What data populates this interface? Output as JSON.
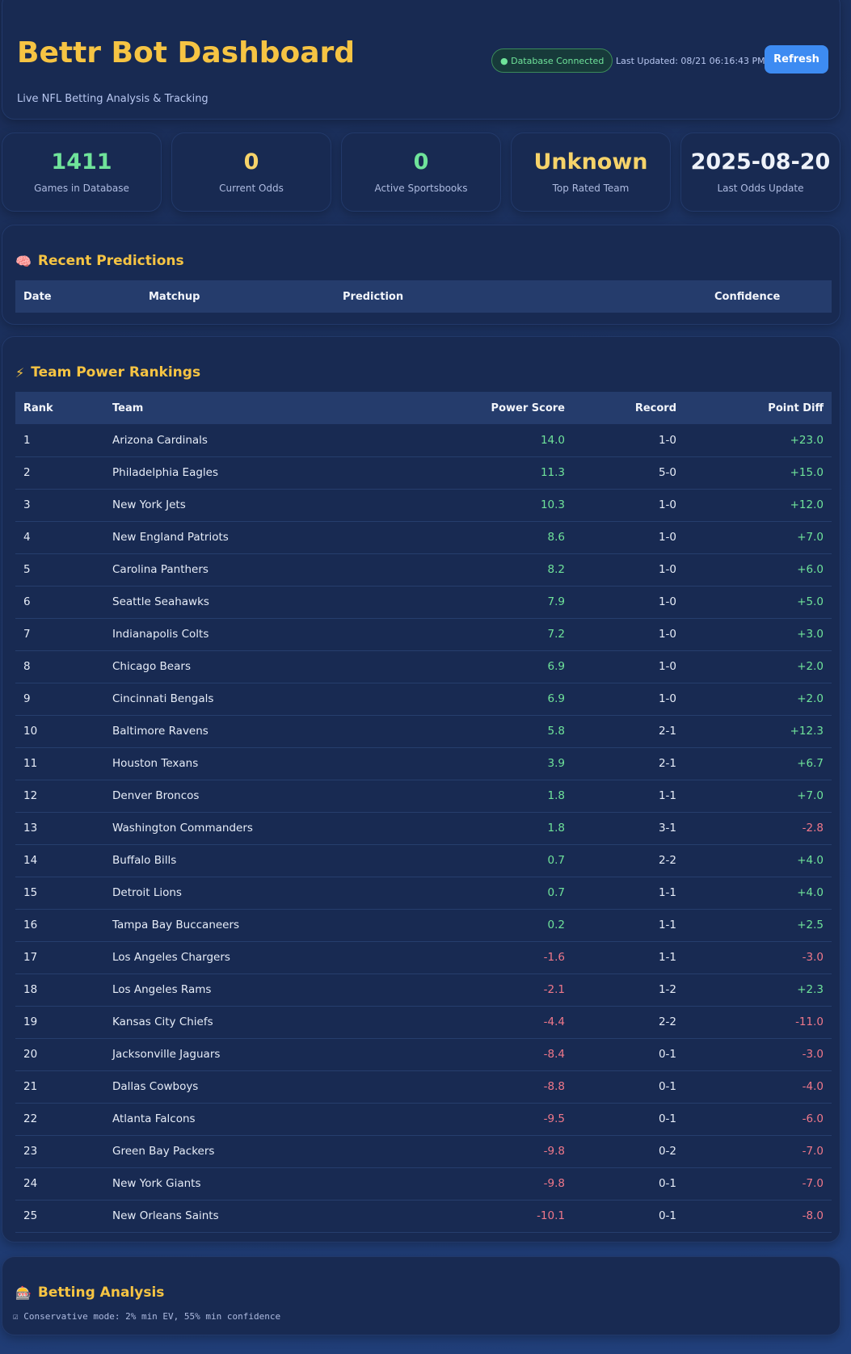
{
  "header": {
    "title": "Bettr Bot Dashboard",
    "subtitle": "Live NFL Betting Analysis & Tracking",
    "status": "● Database Connected",
    "last_updated": "Last Updated: 08/21 06:16:43 PM",
    "refresh_label": "Refresh"
  },
  "stats": [
    {
      "value": "1411",
      "label": "Games in Database",
      "color": "#6fe39a"
    },
    {
      "value": "0",
      "label": "Current Odds",
      "color": "#f6d36a"
    },
    {
      "value": "0",
      "label": "Active Sportsbooks",
      "color": "#6fe39a"
    },
    {
      "value": "Unknown",
      "label": "Top Rated Team",
      "color": "#f6d36a"
    },
    {
      "value": "2025-08-20",
      "label": "Last Odds Update",
      "color": "#eef2f9"
    }
  ],
  "predictions": {
    "icon": "brain-icon",
    "title": "Recent Predictions",
    "columns": [
      "Date",
      "Matchup",
      "Prediction",
      "Confidence"
    ]
  },
  "rankings": {
    "icon": "lightning-icon",
    "title": "Team Power Rankings",
    "columns": [
      "Rank",
      "Team",
      "Power Score",
      "Record",
      "Point Diff"
    ],
    "rows": [
      {
        "rank": "1",
        "team": "Arizona Cardinals",
        "score": "14.0",
        "record": "1-0",
        "diff": "+23.0"
      },
      {
        "rank": "2",
        "team": "Philadelphia Eagles",
        "score": "11.3",
        "record": "5-0",
        "diff": "+15.0"
      },
      {
        "rank": "3",
        "team": "New York Jets",
        "score": "10.3",
        "record": "1-0",
        "diff": "+12.0"
      },
      {
        "rank": "4",
        "team": "New England Patriots",
        "score": "8.6",
        "record": "1-0",
        "diff": "+7.0"
      },
      {
        "rank": "5",
        "team": "Carolina Panthers",
        "score": "8.2",
        "record": "1-0",
        "diff": "+6.0"
      },
      {
        "rank": "6",
        "team": "Seattle Seahawks",
        "score": "7.9",
        "record": "1-0",
        "diff": "+5.0"
      },
      {
        "rank": "7",
        "team": "Indianapolis Colts",
        "score": "7.2",
        "record": "1-0",
        "diff": "+3.0"
      },
      {
        "rank": "8",
        "team": "Chicago Bears",
        "score": "6.9",
        "record": "1-0",
        "diff": "+2.0"
      },
      {
        "rank": "9",
        "team": "Cincinnati Bengals",
        "score": "6.9",
        "record": "1-0",
        "diff": "+2.0"
      },
      {
        "rank": "10",
        "team": "Baltimore Ravens",
        "score": "5.8",
        "record": "2-1",
        "diff": "+12.3"
      },
      {
        "rank": "11",
        "team": "Houston Texans",
        "score": "3.9",
        "record": "2-1",
        "diff": "+6.7"
      },
      {
        "rank": "12",
        "team": "Denver Broncos",
        "score": "1.8",
        "record": "1-1",
        "diff": "+7.0"
      },
      {
        "rank": "13",
        "team": "Washington Commanders",
        "score": "1.8",
        "record": "3-1",
        "diff": "-2.8"
      },
      {
        "rank": "14",
        "team": "Buffalo Bills",
        "score": "0.7",
        "record": "2-2",
        "diff": "+4.0"
      },
      {
        "rank": "15",
        "team": "Detroit Lions",
        "score": "0.7",
        "record": "1-1",
        "diff": "+4.0"
      },
      {
        "rank": "16",
        "team": "Tampa Bay Buccaneers",
        "score": "0.2",
        "record": "1-1",
        "diff": "+2.5"
      },
      {
        "rank": "17",
        "team": "Los Angeles Chargers",
        "score": "-1.6",
        "record": "1-1",
        "diff": "-3.0"
      },
      {
        "rank": "18",
        "team": "Los Angeles Rams",
        "score": "-2.1",
        "record": "1-2",
        "diff": "+2.3"
      },
      {
        "rank": "19",
        "team": "Kansas City Chiefs",
        "score": "-4.4",
        "record": "2-2",
        "diff": "-11.0"
      },
      {
        "rank": "20",
        "team": "Jacksonville Jaguars",
        "score": "-8.4",
        "record": "0-1",
        "diff": "-3.0"
      },
      {
        "rank": "21",
        "team": "Dallas Cowboys",
        "score": "-8.8",
        "record": "0-1",
        "diff": "-4.0"
      },
      {
        "rank": "22",
        "team": "Atlanta Falcons",
        "score": "-9.5",
        "record": "0-1",
        "diff": "-6.0"
      },
      {
        "rank": "23",
        "team": "Green Bay Packers",
        "score": "-9.8",
        "record": "0-2",
        "diff": "-7.0"
      },
      {
        "rank": "24",
        "team": "New York Giants",
        "score": "-9.8",
        "record": "0-1",
        "diff": "-7.0"
      },
      {
        "rank": "25",
        "team": "New Orleans Saints",
        "score": "-10.1",
        "record": "0-1",
        "diff": "-8.0"
      }
    ]
  },
  "analysis": {
    "icon": "slot-machine-icon",
    "title": "Betting Analysis",
    "note": "☑ Conservative mode: 2% min EV, 55% min confidence"
  },
  "colors": {
    "accent": "#f6c443",
    "positive": "#6fe39a",
    "negative": "#f0788a",
    "button": "#3d8bf2"
  }
}
